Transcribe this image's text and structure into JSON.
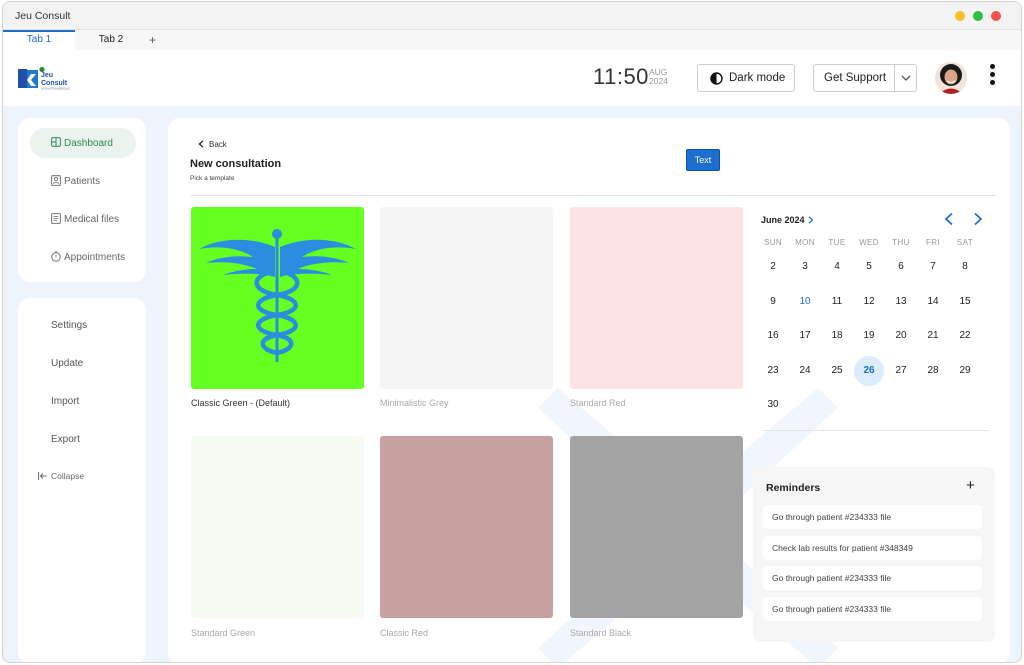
{
  "window": {
    "title": "Jeu Consult"
  },
  "tabs": [
    {
      "label": "Tab 1"
    },
    {
      "label": "Tab 2"
    }
  ],
  "tab_add_label": "+",
  "header": {
    "logo": {
      "line1": "Jeu",
      "line2": "Consult",
      "tagline": "LA SOLUTION MEDICALE"
    },
    "clock": {
      "time": "11:50",
      "month": "AUG",
      "year": "2024"
    },
    "dark_mode_label": "Dark mode",
    "support_label": "Get Support"
  },
  "sidebar": {
    "nav": [
      {
        "label": "Dashboard",
        "icon": "dashboard-icon",
        "active": true
      },
      {
        "label": "Patients",
        "icon": "patients-icon"
      },
      {
        "label": "Medical files",
        "icon": "file-icon"
      },
      {
        "label": "Appointments",
        "icon": "clock-icon"
      }
    ],
    "settings": [
      {
        "label": "Settings"
      },
      {
        "label": "Update"
      },
      {
        "label": "Import"
      },
      {
        "label": "Export"
      }
    ],
    "collapse_label": "Collapse"
  },
  "main": {
    "back_label": "Back",
    "title": "New consultation",
    "subtitle": "Pick a template",
    "action_button": "Text",
    "templates": [
      {
        "name": "Classic Green - (Default)",
        "color": "#66ff22",
        "icon": "caduceus-icon",
        "selected": true
      },
      {
        "name": "Minimalistic Grey",
        "color": "#f5f5f5"
      },
      {
        "name": "Standard Red",
        "color": "#fde3e3"
      },
      {
        "name": "Standard Green",
        "color": "#f6fbf4"
      },
      {
        "name": "Classic Red",
        "color": "#c9a0a0"
      },
      {
        "name": "Standard Black",
        "color": "#a3a3a3"
      }
    ]
  },
  "calendar": {
    "month_label": "June 2024",
    "weekdays": [
      "SUN",
      "MON",
      "TUE",
      "WED",
      "THU",
      "FRI",
      "SAT"
    ],
    "weeks": [
      [
        "2",
        "3",
        "4",
        "5",
        "6",
        "7",
        "8"
      ],
      [
        "9",
        "10",
        "11",
        "12",
        "13",
        "14",
        "15"
      ],
      [
        "16",
        "17",
        "18",
        "19",
        "20",
        "21",
        "22"
      ],
      [
        "23",
        "24",
        "25",
        "26",
        "27",
        "28",
        "29"
      ],
      [
        "30"
      ]
    ],
    "highlighted_day": "10",
    "selected_day": "26"
  },
  "reminders": {
    "title": "Reminders",
    "add_label": "+",
    "items": [
      "Go through patient #234333 file",
      "Check lab results for patient #348349",
      "Go through patient #234333 file",
      "Go through patient #234333 file"
    ]
  },
  "colors": {
    "accent": "#1a6fcf",
    "active_nav": "#2e8b57",
    "primary_button": "#1c6fcf"
  }
}
